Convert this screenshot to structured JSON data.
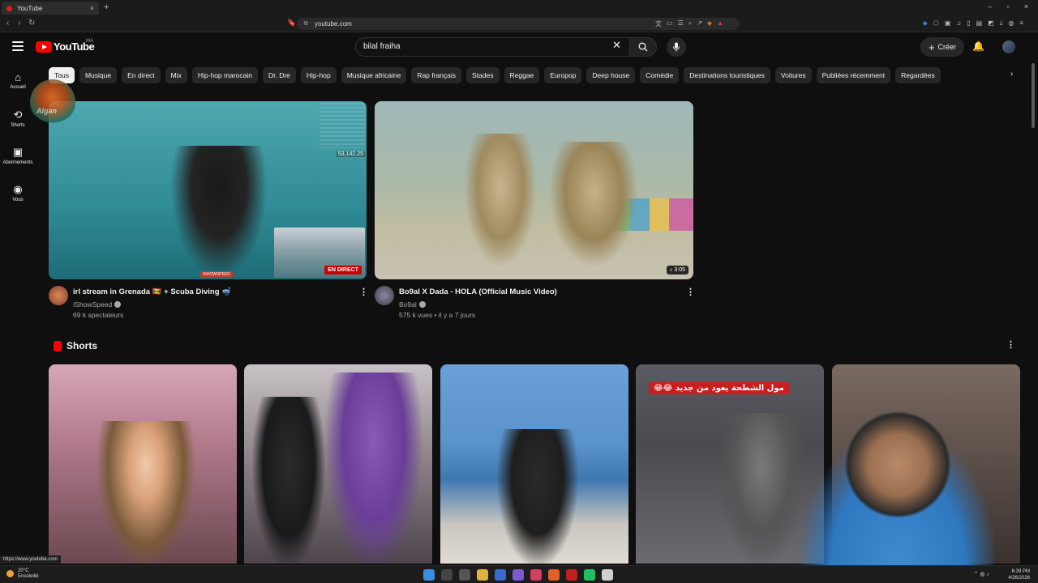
{
  "browser": {
    "tab_title": "YouTube",
    "tab_close": "×",
    "new_tab": "+",
    "url": "youtube.com",
    "window_controls": [
      "–",
      "▫",
      "×"
    ],
    "status_link": "https://www.youtube.com"
  },
  "header": {
    "logo_text": "YouTube",
    "country_code": "MA",
    "search_value": "bilal fraiha",
    "create_label": "Créer"
  },
  "sidebar": {
    "items": [
      {
        "label": "Accueil",
        "icon": "home-icon"
      },
      {
        "label": "Shorts",
        "icon": "shorts-icon"
      },
      {
        "label": "Abonnements",
        "icon": "subscriptions-icon"
      },
      {
        "label": "Vous",
        "icon": "you-icon"
      }
    ]
  },
  "chips": [
    "Tous",
    "Musique",
    "En direct",
    "Mix",
    "Hip-hop marocain",
    "Dr. Dre",
    "Hip-hop",
    "Musique africaine",
    "Rap français",
    "Stades",
    "Reggae",
    "Europop",
    "Deep house",
    "Comédie",
    "Destinations touristiques",
    "Voitures",
    "Publiées récemment",
    "Regardées"
  ],
  "watermark": {
    "text": "Algan"
  },
  "videos": [
    {
      "title": "irl stream in Grenada 🇬🇩 + Scuba Diving 🤿",
      "channel": "IShowSpeed",
      "stats": "69 k spectateurs",
      "badge": "EN DIRECT",
      "overlay_counter": "53,142,25",
      "handle_tag": "ISHOWSPEED"
    },
    {
      "title": "Bo9al X Dada - HOLA (Official Music Video)",
      "channel": "Bo9al",
      "stats": "575 k vues • il y a 7 jours",
      "duration": "3:05"
    }
  ],
  "shorts": {
    "title": "Shorts",
    "items": [
      {
        "banner": ""
      },
      {
        "banner": ""
      },
      {
        "banner": ""
      },
      {
        "banner": "مول الشطحة يعود من جديد 😂😂"
      },
      {
        "banner": ""
      }
    ]
  },
  "taskbar": {
    "weather_temp": "20°C",
    "weather_desc": "Ensoleillé",
    "time": "6:39 PM",
    "date": "4/26/2026"
  },
  "colors": {
    "brand_red": "#ff0000",
    "live_red": "#cc0000",
    "bg": "#0f0f0f"
  }
}
